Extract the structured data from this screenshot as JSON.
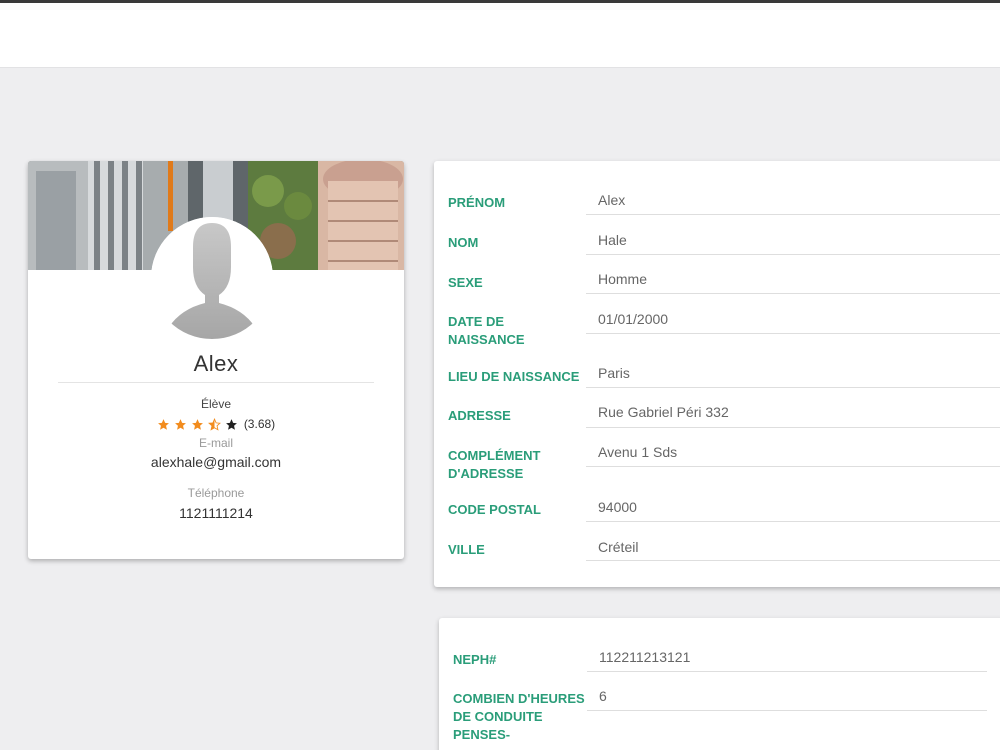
{
  "profile": {
    "name": "Alex",
    "role": "Élève",
    "rating": {
      "value": 3.5,
      "max": 5,
      "label": "(3.68)"
    },
    "email_label": "E-mail",
    "email": "alexhale@gmail.com",
    "phone_label": "Téléphone",
    "phone": "1121111214"
  },
  "info": {
    "fields": [
      {
        "label": "PRÉNOM",
        "value": "Alex"
      },
      {
        "label": "NOM",
        "value": "Hale"
      },
      {
        "label": "SEXE",
        "value": "Homme"
      },
      {
        "label": "DATE DE NAISSANCE",
        "value": "01/01/2000"
      },
      {
        "label": "LIEU DE NAISSANCE",
        "value": "Paris"
      },
      {
        "label": "ADRESSE",
        "value": "Rue Gabriel Péri 332"
      },
      {
        "label": "COMPLÉMENT D'ADRESSE",
        "value": "Avenu 1 Sds"
      },
      {
        "label": "CODE POSTAL",
        "value": "94000"
      },
      {
        "label": "VILLE",
        "value": "Créteil"
      }
    ]
  },
  "license": {
    "fields": [
      {
        "label": "NEPH#",
        "value": "112211213121"
      },
      {
        "label": "COMBIEN D'HEURES DE CONDUITE PENSES-",
        "value": "6"
      }
    ]
  },
  "colors": {
    "accent": "#2a9d79",
    "star": "#f28c1e",
    "background": "#eeeef0"
  }
}
